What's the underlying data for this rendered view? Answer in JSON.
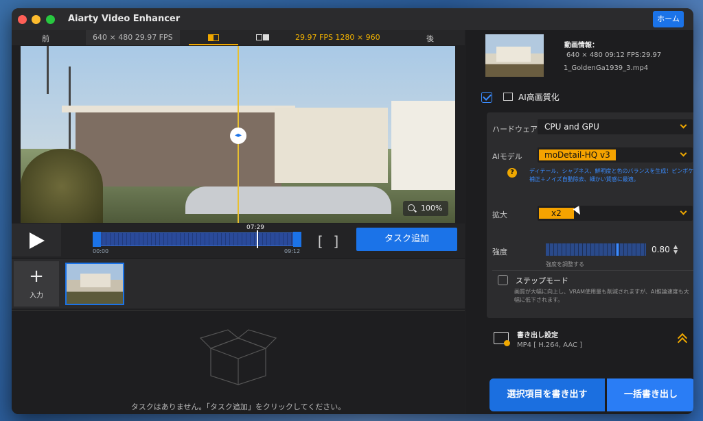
{
  "window": {
    "title": "Aiarty Video Enhancer",
    "home_label": "ホーム"
  },
  "compare": {
    "before_label": "前",
    "before_info": "640 × 480   29.97 FPS",
    "after_info": "29.97 FPS   1280 × 960",
    "after_label": "後"
  },
  "preview": {
    "zoom": "100%"
  },
  "timeline": {
    "current": "07:29",
    "start": "00:00",
    "end": "09:12"
  },
  "transport": {
    "add_task_label": "タスク追加"
  },
  "clips": {
    "add_label": "入力"
  },
  "tasks": {
    "empty_message": "タスクはありません。「タスク追加」をクリックしてください。"
  },
  "video_info": {
    "title": "動画情報：",
    "line": "640 × 480 09:12 FPS:29.97",
    "file": "1_GoldenGa1939_3.mp4"
  },
  "ai": {
    "title": "AI高画質化",
    "hardware_label": "ハードウェア",
    "hardware_value": "CPU and GPU",
    "model_label": "AIモデル",
    "model_value": "moDetail-HQ  v3",
    "model_desc": "ディテール、シャプネス、鮮明度と色のバランスを生成！ピンボケ補正＋ノイズ自動除去、細かい質感に最適。",
    "scale_label": "拡大",
    "scale_value": "x2",
    "strength_label": "強度",
    "strength_value": "0.80",
    "strength_hint": "強度を調整する",
    "strength_level": 0.8,
    "step_mode_title": "ステップモード",
    "step_mode_desc": "画質が大幅に向上し、VRAM使用量も削減されますが、AI推論速度も大幅に低下されます。"
  },
  "export": {
    "settings_title": "書き出し設定",
    "format": "MP4 [ H.264, AAC ]",
    "export_selected_label": "選択項目を書き出す",
    "export_all_label": "一括書き出し"
  },
  "colors": {
    "accent": "#1b73e8",
    "highlight": "#f5a300",
    "background": "#1f1f21"
  }
}
